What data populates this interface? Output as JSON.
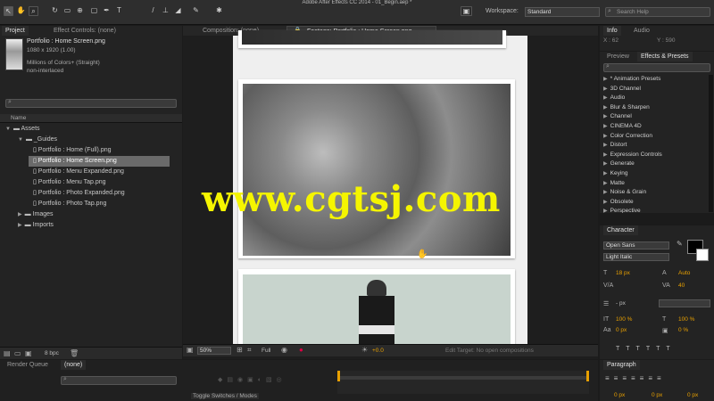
{
  "app": {
    "title": "Adobe After Effects CC 2014 - 01_Begin.aep *"
  },
  "toolbar": {
    "workspace_label": "Workspace:",
    "workspace_value": "Standard",
    "search_placeholder": "Search Help"
  },
  "project_panel": {
    "tab_label": "Project",
    "effect_controls_tab": "Effect Controls: (none)",
    "file_name": "Portfolio : Home Screen.png",
    "file_dims": "1080 x 1920 (1.00)",
    "file_colors": "Millions of Colors+ (Straight)",
    "file_interlace": "non-interlaced",
    "column_name": "Name",
    "bpc": "8 bpc",
    "tree": [
      {
        "label": "Assets",
        "depth": 0,
        "type": "folder",
        "open": true
      },
      {
        "label": "_Guides",
        "depth": 1,
        "type": "folder",
        "open": true
      },
      {
        "label": "Portfolio : Home (Full).png",
        "depth": 2,
        "type": "file"
      },
      {
        "label": "Portfolio : Home Screen.png",
        "depth": 2,
        "type": "file",
        "selected": true
      },
      {
        "label": "Portfolio : Menu Expanded.png",
        "depth": 2,
        "type": "file"
      },
      {
        "label": "Portfolio : Menu Tap.png",
        "depth": 2,
        "type": "file"
      },
      {
        "label": "Portfolio : Photo Expanded.png",
        "depth": 2,
        "type": "file"
      },
      {
        "label": "Portfolio : Photo Tap.png",
        "depth": 2,
        "type": "file"
      },
      {
        "label": "Images",
        "depth": 1,
        "type": "folder",
        "open": false
      },
      {
        "label": "Imports",
        "depth": 1,
        "type": "folder",
        "open": false
      }
    ]
  },
  "viewer": {
    "comp_tab": "Composition: (none)",
    "footage_tab": "Footage: Portfolio : Home Screen.png",
    "zoom": "50%",
    "resolution": "Full",
    "exposure": "+0.0",
    "edit_target": "Edit Target: No open compositions"
  },
  "watermark": "www.cgtsj.com",
  "right_panel": {
    "info_tab": "Info",
    "audio_tab": "Audio",
    "info_x": "X : 62",
    "info_y": "Y : 590",
    "preview_tab": "Preview",
    "effects_tab": "Effects & Presets",
    "effects": [
      "* Animation Presets",
      "3D Channel",
      "Audio",
      "Blur & Sharpen",
      "Channel",
      "CINEMA 4D",
      "Color Correction",
      "Distort",
      "Expression Controls",
      "Generate",
      "Keying",
      "Matte",
      "Noise & Grain",
      "Obsolete",
      "Perspective"
    ]
  },
  "character_panel": {
    "tab": "Character",
    "font": "Open Sans",
    "style": "Light Italic",
    "size": "18 px",
    "leading": "Auto",
    "kerning": "",
    "tracking": "40",
    "stroke": "- px",
    "vscale": "100 %",
    "hscale": "100 %",
    "baseline": "0 px",
    "tsume": "0 %"
  },
  "bottom": {
    "render_queue_tab": "Render Queue",
    "timeline_tab": "(none)",
    "toggle_label": "Toggle Switches / Modes",
    "paragraph_tab": "Paragraph",
    "para_values": [
      "0 px",
      "0 px",
      "0 px"
    ]
  },
  "colors": {
    "accent": "#e8a000",
    "watermark": "#f5f500",
    "panel": "#232323"
  }
}
